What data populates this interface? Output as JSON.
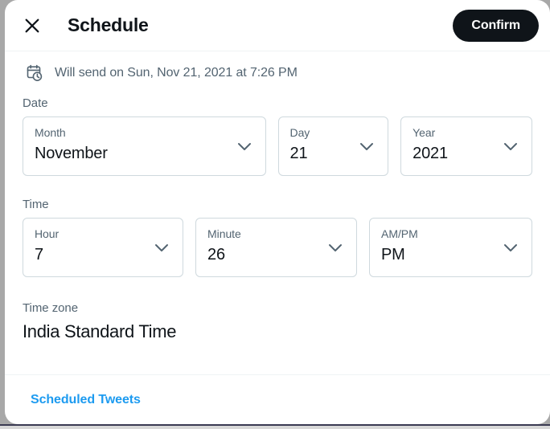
{
  "dialog": {
    "title": "Schedule",
    "close_icon": "close-icon",
    "confirm_label": "Confirm"
  },
  "summary": {
    "icon": "calendar-clock-icon",
    "text": "Will send on Sun, Nov 21, 2021 at 7:26 PM"
  },
  "date": {
    "section_label": "Date",
    "fields": [
      {
        "label": "Month",
        "value": "November"
      },
      {
        "label": "Day",
        "value": "21"
      },
      {
        "label": "Year",
        "value": "2021"
      }
    ]
  },
  "time": {
    "section_label": "Time",
    "fields": [
      {
        "label": "Hour",
        "value": "7"
      },
      {
        "label": "Minute",
        "value": "26"
      },
      {
        "label": "AM/PM",
        "value": "PM"
      }
    ]
  },
  "timezone": {
    "section_label": "Time zone",
    "value": "India Standard Time"
  },
  "footer": {
    "link_label": "Scheduled Tweets"
  },
  "colors": {
    "accent_blue": "#1d9bf0",
    "text_primary": "#0f1419",
    "text_secondary": "#536471",
    "border": "#cfd9de",
    "divider": "#eff3f4",
    "confirm_bg": "#0f1419"
  }
}
